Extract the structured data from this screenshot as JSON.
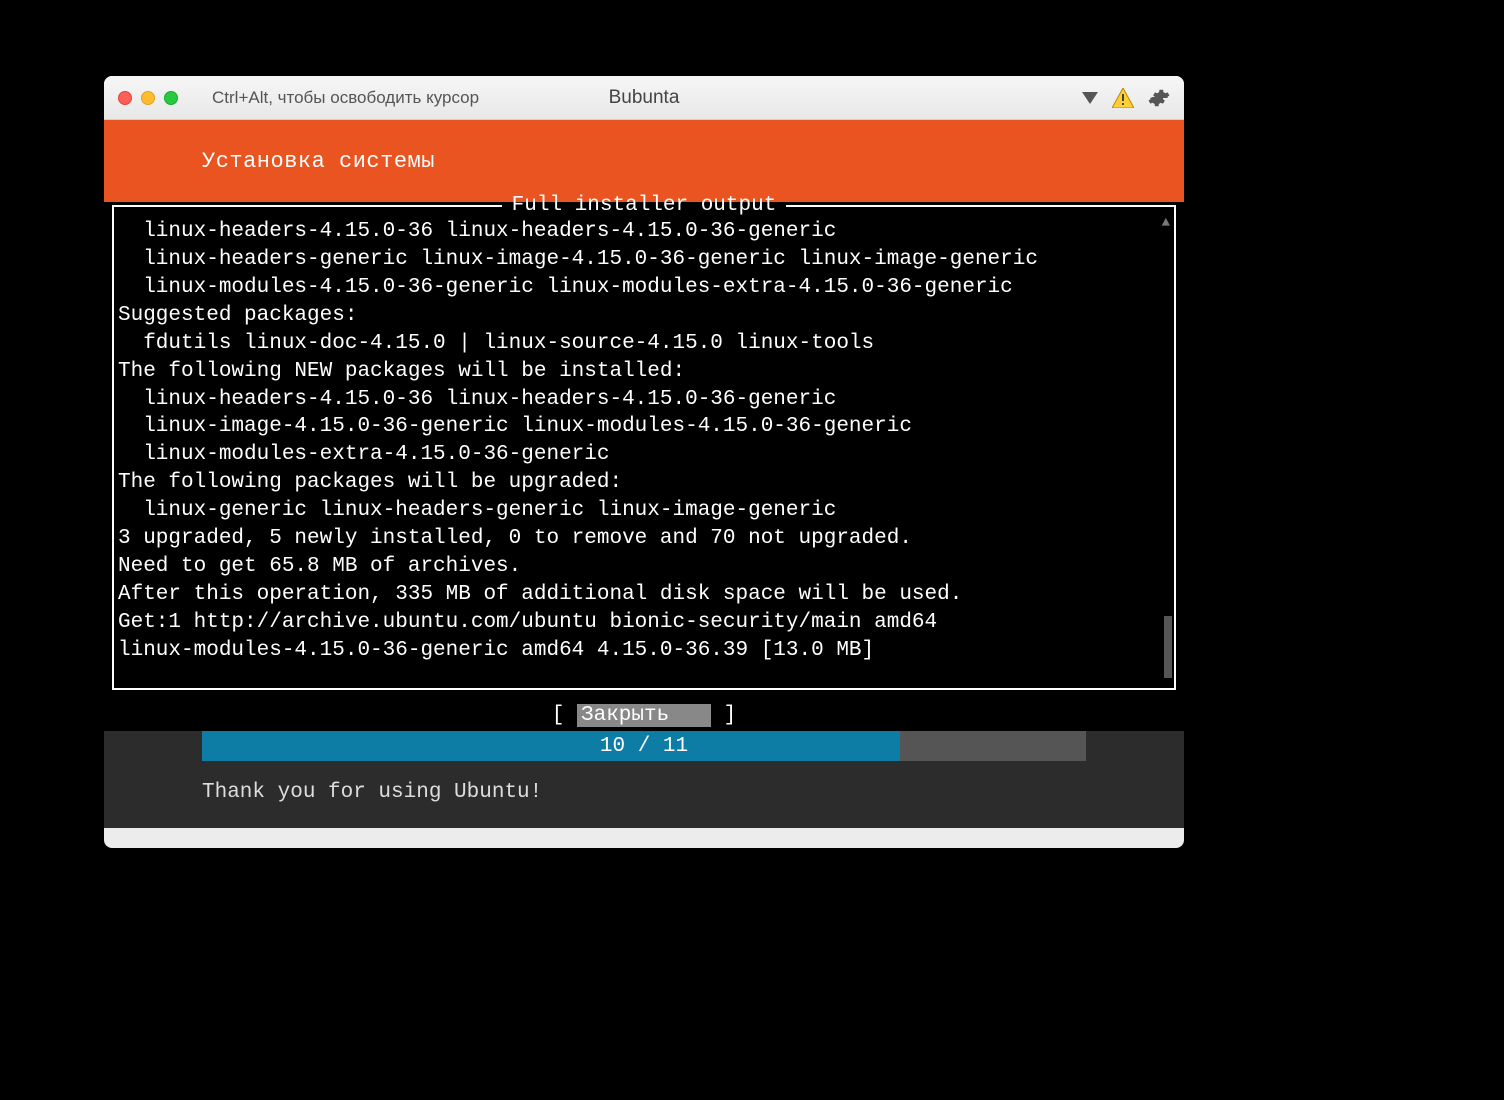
{
  "titlebar": {
    "hint": "Ctrl+Alt, чтобы освободить курсор",
    "title": "Bubunta"
  },
  "header": {
    "label": "Установка системы"
  },
  "terminal": {
    "title": "Full installer output",
    "lines": [
      "  linux-headers-4.15.0-36 linux-headers-4.15.0-36-generic",
      "  linux-headers-generic linux-image-4.15.0-36-generic linux-image-generic",
      "  linux-modules-4.15.0-36-generic linux-modules-extra-4.15.0-36-generic",
      "Suggested packages:",
      "  fdutils linux-doc-4.15.0 | linux-source-4.15.0 linux-tools",
      "The following NEW packages will be installed:",
      "  linux-headers-4.15.0-36 linux-headers-4.15.0-36-generic",
      "  linux-image-4.15.0-36-generic linux-modules-4.15.0-36-generic",
      "  linux-modules-extra-4.15.0-36-generic",
      "The following packages will be upgraded:",
      "  linux-generic linux-headers-generic linux-image-generic",
      "3 upgraded, 5 newly installed, 0 to remove and 70 not upgraded.",
      "Need to get 65.8 MB of archives.",
      "After this operation, 335 MB of additional disk space will be used.",
      "Get:1 http://archive.ubuntu.com/ubuntu bionic-security/main amd64",
      "linux-modules-4.15.0-36-generic amd64 4.15.0-36.39 [13.0 MB]"
    ]
  },
  "button": {
    "close_label": "Закрыть"
  },
  "progress": {
    "current": 10,
    "total": 11,
    "label": "10 / 11",
    "percent": 79
  },
  "footer": {
    "thanks": "Thank you for using Ubuntu!"
  }
}
